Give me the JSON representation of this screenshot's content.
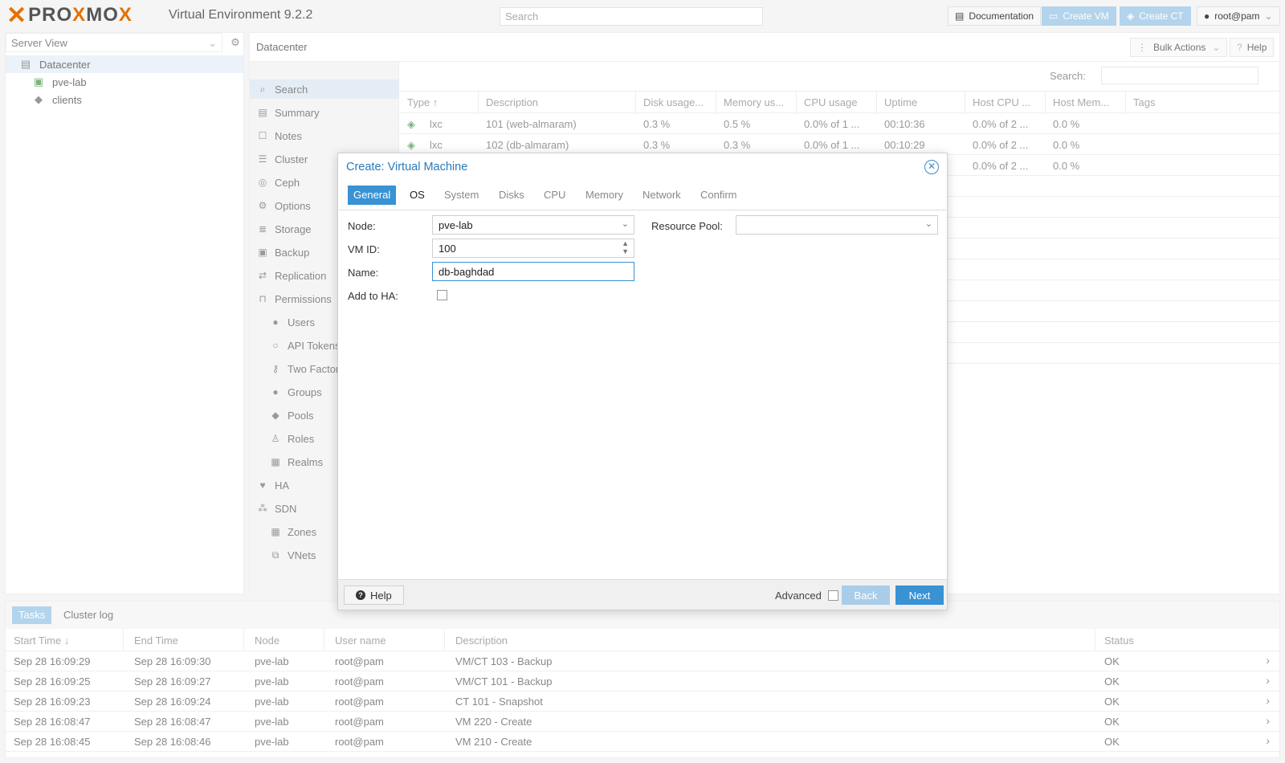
{
  "topbar": {
    "logo": "PROXMOX",
    "app_title": "Virtual Environment 9.2.2",
    "search_placeholder": "Search",
    "documentation": "Documentation",
    "create_vm": "Create VM",
    "create_ct": "Create CT",
    "user": "root@pam"
  },
  "tree": {
    "view": "Server View",
    "items": [
      {
        "label": "Datacenter",
        "icon": "datacenter-icon"
      },
      {
        "label": "pve-lab",
        "icon": "node-icon"
      },
      {
        "label": "clients",
        "icon": "tags-icon"
      }
    ]
  },
  "content": {
    "breadcrumb": "Datacenter",
    "bulk_actions": "Bulk Actions",
    "help": "Help",
    "search_label": "Search:"
  },
  "submenu": [
    {
      "label": "Search",
      "icon": "search-icon"
    },
    {
      "label": "Summary",
      "icon": "book-icon"
    },
    {
      "label": "Notes",
      "icon": "note-icon"
    },
    {
      "label": "Cluster",
      "icon": "server-icon"
    },
    {
      "label": "Ceph",
      "icon": "ceph-icon"
    },
    {
      "label": "Options",
      "icon": "gear-icon"
    },
    {
      "label": "Storage",
      "icon": "database-icon"
    },
    {
      "label": "Backup",
      "icon": "floppy-icon"
    },
    {
      "label": "Replication",
      "icon": "retweet-icon"
    },
    {
      "label": "Permissions",
      "icon": "unlock-icon"
    },
    {
      "label": "Users",
      "icon": "user-icon"
    },
    {
      "label": "API Tokens",
      "icon": "user-outline-icon"
    },
    {
      "label": "Two Factor",
      "icon": "key-icon"
    },
    {
      "label": "Groups",
      "icon": "users-icon"
    },
    {
      "label": "Pools",
      "icon": "tags-icon"
    },
    {
      "label": "Roles",
      "icon": "male-icon"
    },
    {
      "label": "Realms",
      "icon": "address-book-icon"
    },
    {
      "label": "HA",
      "icon": "heartbeat-icon"
    },
    {
      "label": "SDN",
      "icon": "sdn-icon"
    },
    {
      "label": "Zones",
      "icon": "grid-icon"
    },
    {
      "label": "VNets",
      "icon": "network-icon"
    }
  ],
  "grid": {
    "columns": [
      "Type ↑",
      "Description",
      "Disk usage...",
      "Memory us...",
      "CPU usage",
      "Uptime",
      "Host CPU ...",
      "Host Mem...",
      "Tags"
    ],
    "rows": [
      {
        "type": "lxc",
        "desc": "101 (web-almaram)",
        "disk": "0.3 %",
        "mem": "0.5 %",
        "cpu": "0.0% of 1 ...",
        "uptime": "00:10:36",
        "hostcpu": "0.0% of 2 ...",
        "hostmem": "0.0 %"
      },
      {
        "type": "lxc",
        "desc": "102 (db-almaram)",
        "disk": "0.3 %",
        "mem": "0.3 %",
        "cpu": "0.0% of 1 ...",
        "uptime": "00:10:29",
        "hostcpu": "0.0% of 2 ...",
        "hostmem": "0.0 %"
      },
      {
        "type": "",
        "desc": "",
        "disk": "",
        "mem": "",
        "cpu": "",
        "uptime": "",
        "hostcpu": "0.0% of 2 ...",
        "hostmem": "0.0 %"
      }
    ]
  },
  "modal": {
    "title": "Create: Virtual Machine",
    "tabs": [
      "General",
      "OS",
      "System",
      "Disks",
      "CPU",
      "Memory",
      "Network",
      "Confirm"
    ],
    "fields": {
      "node_label": "Node:",
      "node_value": "pve-lab",
      "vmid_label": "VM ID:",
      "vmid_value": "100",
      "name_label": "Name:",
      "name_value": "db-baghdad",
      "ha_label": "Add to HA:",
      "pool_label": "Resource Pool:",
      "pool_value": ""
    },
    "footer": {
      "help": "Help",
      "advanced": "Advanced",
      "back": "Back",
      "next": "Next"
    }
  },
  "tasks": {
    "tabs": [
      "Tasks",
      "Cluster log"
    ],
    "columns": [
      "Start Time ↓",
      "End Time",
      "Node",
      "User name",
      "Description",
      "Status"
    ],
    "rows": [
      {
        "start": "Sep 28 16:09:29",
        "end": "Sep 28 16:09:30",
        "node": "pve-lab",
        "user": "root@pam",
        "desc": "VM/CT 103 - Backup",
        "status": "OK"
      },
      {
        "start": "Sep 28 16:09:25",
        "end": "Sep 28 16:09:27",
        "node": "pve-lab",
        "user": "root@pam",
        "desc": "VM/CT 101 - Backup",
        "status": "OK"
      },
      {
        "start": "Sep 28 16:09:23",
        "end": "Sep 28 16:09:24",
        "node": "pve-lab",
        "user": "root@pam",
        "desc": "CT 101 - Snapshot",
        "status": "OK"
      },
      {
        "start": "Sep 28 16:08:47",
        "end": "Sep 28 16:08:47",
        "node": "pve-lab",
        "user": "root@pam",
        "desc": "VM 220 - Create",
        "status": "OK"
      },
      {
        "start": "Sep 28 16:08:45",
        "end": "Sep 28 16:08:46",
        "node": "pve-lab",
        "user": "root@pam",
        "desc": "VM 210 - Create",
        "status": "OK"
      }
    ]
  },
  "colors": {
    "accent": "#3892d4",
    "brand_orange": "#e57000",
    "title_blue": "#2a7ab8"
  }
}
